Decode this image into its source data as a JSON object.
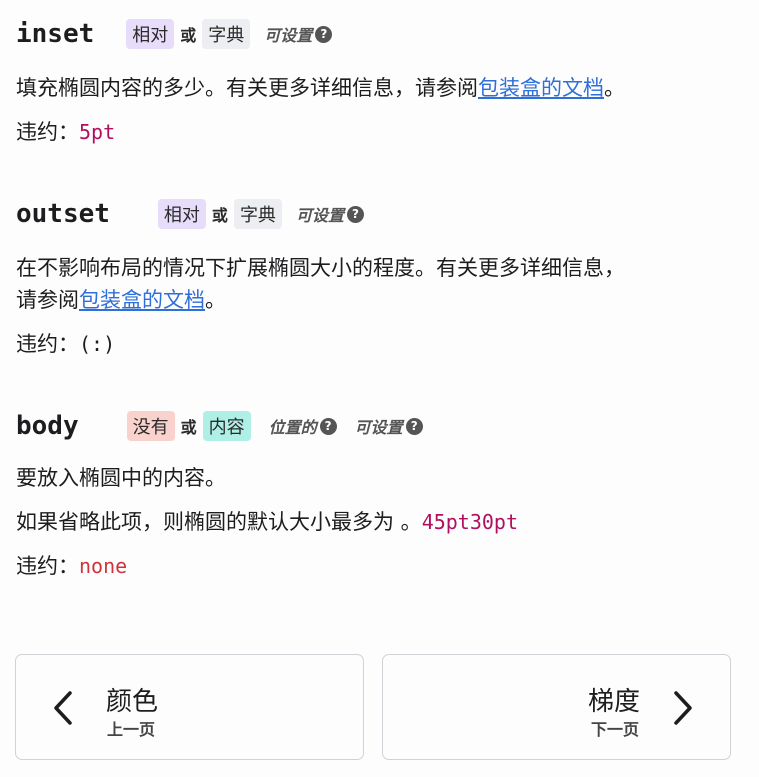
{
  "params": [
    {
      "name": "inset",
      "types": [
        "相对",
        "字典"
      ],
      "or_word": "或",
      "flags": [
        "可设置"
      ],
      "description_pre": "填充椭圆内容的多少。有关更多详细信息，请参阅",
      "description_link": "包装盒的文档",
      "description_post": "。",
      "default_label": "违约：",
      "default_value": "5pt"
    },
    {
      "name": "outset",
      "types": [
        "相对",
        "字典"
      ],
      "or_word": "或",
      "flags": [
        "可设置"
      ],
      "description_line1": "在不影响布局的情况下扩展椭圆大小的程度。有关更多详细信息，",
      "description_pre": "请参阅",
      "description_link": "包装盒的文档",
      "description_post": "。",
      "default_label": "违约：",
      "default_value": "(:)"
    },
    {
      "name": "body",
      "types": [
        "没有",
        "内容"
      ],
      "or_word": "或",
      "flags": [
        "位置的",
        "可设置"
      ],
      "description": "要放入椭圆中的内容。",
      "note_pre": "如果省略此项，则椭圆的默认大小最多为 。",
      "note_code": "45pt30pt",
      "default_label": "违约：",
      "default_value": "none"
    }
  ],
  "help_glyph": "?",
  "navigation": {
    "prev": {
      "title": "颜色",
      "subtitle": "上一页",
      "icon": "chevron-left-icon"
    },
    "next": {
      "title": "梯度",
      "subtitle": "下一页",
      "icon": "chevron-right-icon"
    }
  }
}
